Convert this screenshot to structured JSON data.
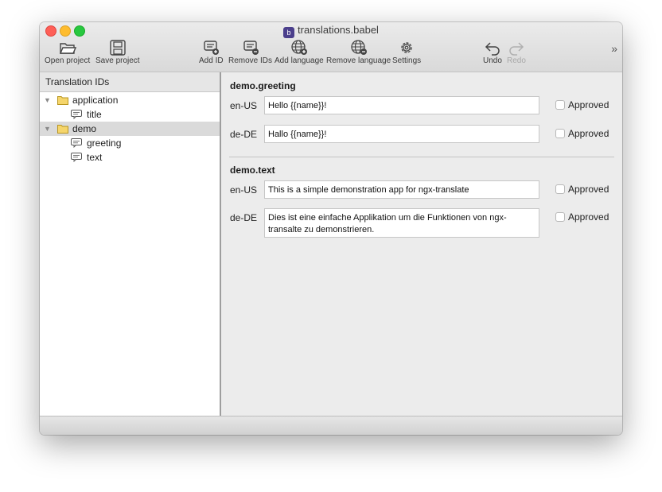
{
  "window": {
    "title": "translations.babel"
  },
  "toolbar": {
    "open_project": "Open project",
    "save_project": "Save project",
    "add_id": "Add ID",
    "remove_ids": "Remove IDs",
    "add_language": "Add language",
    "remove_language": "Remove language",
    "settings": "Settings",
    "undo": "Undo",
    "redo": "Redo",
    "overflow": "»"
  },
  "sidebar": {
    "header": "Translation IDs",
    "tree": [
      {
        "label": "application",
        "type": "folder",
        "expanded": true
      },
      {
        "label": "title",
        "type": "id"
      },
      {
        "label": "demo",
        "type": "folder",
        "expanded": true,
        "selected": true
      },
      {
        "label": "greeting",
        "type": "id"
      },
      {
        "label": "text",
        "type": "id"
      }
    ]
  },
  "sections": [
    {
      "title": "demo.greeting",
      "rows": [
        {
          "lang": "en-US",
          "value": "Hello {{name}}!",
          "approved_label": "Approved",
          "approved": false
        },
        {
          "lang": "de-DE",
          "value": "Hallo {{name}}!",
          "approved_label": "Approved",
          "approved": false
        }
      ]
    },
    {
      "title": "demo.text",
      "rows": [
        {
          "lang": "en-US",
          "value": "This is a simple demonstration app for ngx-translate",
          "approved_label": "Approved",
          "approved": false
        },
        {
          "lang": "de-DE",
          "value": "Dies ist eine einfache Applikation um die Funktionen von ngx-transalte zu demonstrieren.",
          "approved_label": "Approved",
          "approved": false
        }
      ]
    }
  ],
  "colors": {
    "app_icon": "#4b3f8c",
    "selection": "#dadada",
    "folder": "#f5d56b"
  }
}
